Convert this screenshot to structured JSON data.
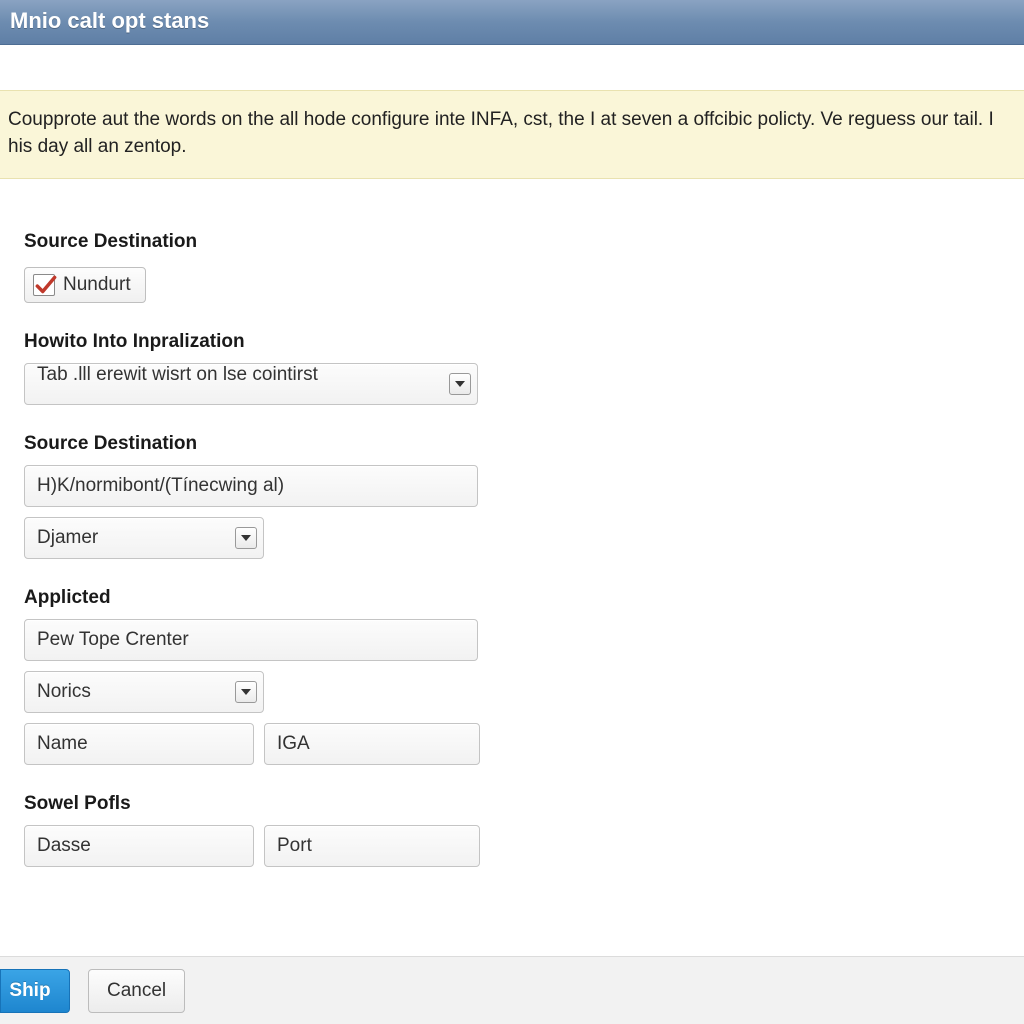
{
  "window": {
    "title": "Mnio calt opt stans"
  },
  "notice": {
    "text": "Coupprote aut the words on the all hode configure inte INFA, cst, the I at seven a offcibic policty. Ve reguess our tail. I his day all an zentop."
  },
  "form": {
    "section1": {
      "label": "Source Destination",
      "checkbox_label": "Nundurt",
      "checkbox_checked": true
    },
    "section2": {
      "label": "Howito Into Inpralization",
      "select_value": "Tab .lll erewit wisrt on lse cointirst"
    },
    "section3": {
      "label": "Source Destination",
      "input_value": "H)K/normibont/(Tínecwing al)",
      "select_value": "Djamer"
    },
    "section4": {
      "label": "Applicted",
      "input_value": "Pew Tope Crenter",
      "select_value": "Norics",
      "pair_left": "Name",
      "pair_right": "IGA"
    },
    "section5": {
      "label": "Sowel Pofls",
      "pair_left": "Dasse",
      "pair_right": "Port"
    }
  },
  "footer": {
    "primary_label": "Ship",
    "cancel_label": "Cancel"
  },
  "colors": {
    "accent": "#1e86cf",
    "notice_bg": "#faf6d8",
    "check_red": "#c0392b"
  }
}
